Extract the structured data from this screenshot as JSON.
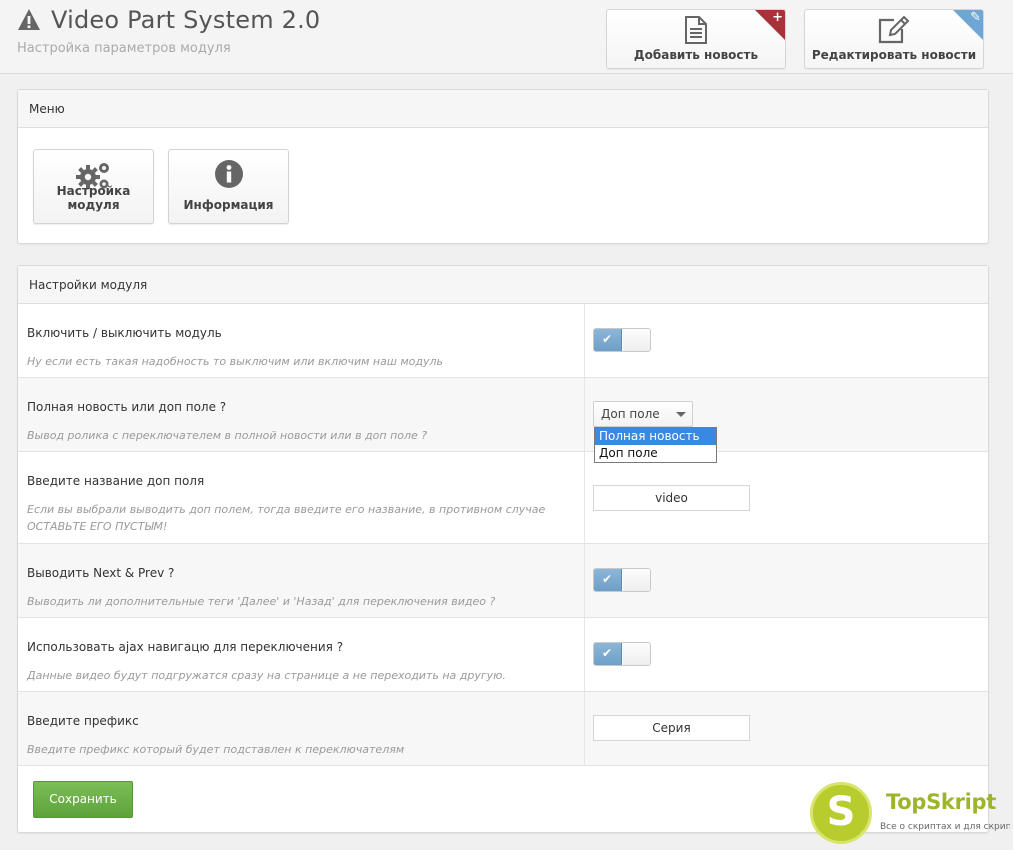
{
  "header": {
    "title": "Video Part System 2.0",
    "subtitle": "Настройка параметров модуля",
    "buttons": {
      "add": "Добавить новость",
      "edit": "Редактировать новости"
    }
  },
  "menu": {
    "title": "Меню",
    "items": [
      {
        "label": "Настройка модуля",
        "icon": "gears-icon"
      },
      {
        "label": "Информация",
        "icon": "info-icon"
      }
    ]
  },
  "settings": {
    "title": "Настройки модуля",
    "rows": [
      {
        "label": "Включить / выключить модуль",
        "desc": "Ну если есть такая надобность то выключим или включим наш модуль",
        "control": "toggle",
        "value": true
      },
      {
        "label": "Полная новость или доп поле ?",
        "desc": "Вывод ролика с переключателем в полной новости или в доп поле ?",
        "control": "select",
        "value": "Доп поле",
        "options": [
          "Полная новость",
          "Доп поле"
        ],
        "highlighted": "Полная новость"
      },
      {
        "label": "Введите название доп поля",
        "desc": "Если вы выбрали выводить доп полем, тогда введите его название, в противном случае ОСТАВЬТЕ ЕГО ПУСТЫМ!",
        "control": "text",
        "value": "video"
      },
      {
        "label": "Выводить Next & Prev ?",
        "desc": "Выводить ли дополнительные теги 'Далее' и 'Назад' для переключения видео ?",
        "control": "toggle",
        "value": true
      },
      {
        "label": "Использовать ajax навигацю для переключения ?",
        "desc": "Данные видео будут подгружатся сразу на странице а не переходить на другую.",
        "control": "toggle",
        "value": true
      },
      {
        "label": "Введите префикс",
        "desc": "Введите префикс который будет подставлен к переключателям",
        "control": "text",
        "value": "Серия"
      }
    ],
    "save_label": "Сохранить"
  },
  "watermark": {
    "letter": "S",
    "brand": "TopSkript",
    "tagline": "Все о скриптах и для скриптов..."
  },
  "colors": {
    "save_green": "#6aaf44",
    "toggle_blue": "#7aa9d0",
    "add_corner": "#a8323a",
    "edit_corner": "#6fa6d3",
    "select_highlight": "#3b88e3"
  }
}
